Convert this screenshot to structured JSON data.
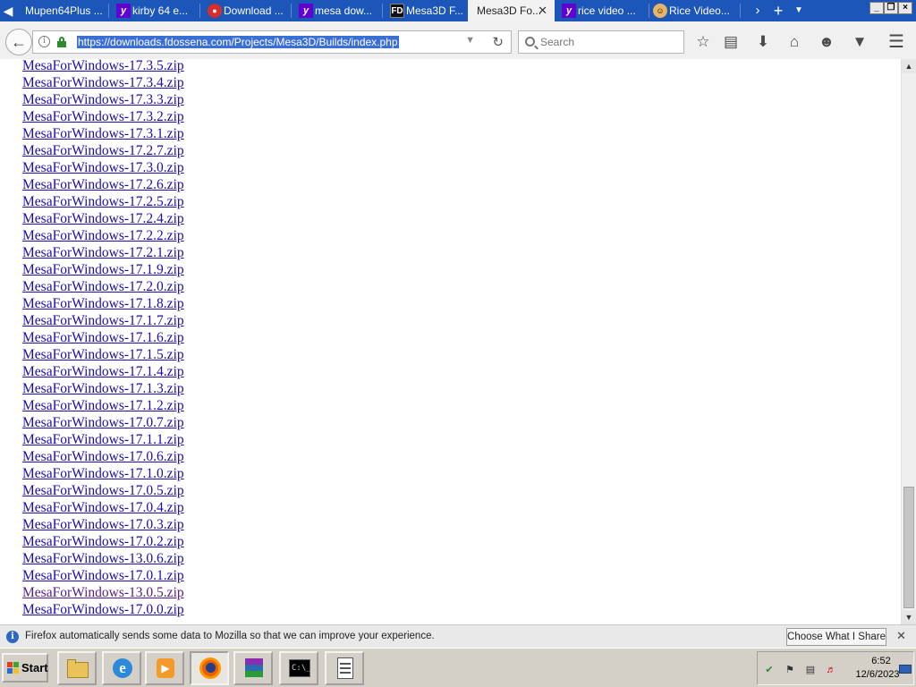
{
  "browser": {
    "tabs": [
      {
        "title": "Mupen64Plus ...",
        "icon": "none",
        "active": false
      },
      {
        "title": "kirby 64 e...",
        "icon": "yahoo",
        "active": false
      },
      {
        "title": "Download ...",
        "icon": "download",
        "active": false
      },
      {
        "title": "mesa dow...",
        "icon": "yahoo",
        "active": false
      },
      {
        "title": "Mesa3D F...",
        "icon": "fd",
        "active": false
      },
      {
        "title": "Mesa3D Fo...",
        "icon": "none",
        "active": true
      },
      {
        "title": "rice video ...",
        "icon": "yahoo",
        "active": false
      },
      {
        "title": "Rice Video...",
        "icon": "rice",
        "active": false
      }
    ],
    "url": "https://downloads.fdossena.com/Projects/Mesa3D/Builds/index.php",
    "search_placeholder": "Search"
  },
  "files": [
    {
      "name": "MesaForWindows-17.3.5.zip",
      "visited": false
    },
    {
      "name": "MesaForWindows-17.3.4.zip",
      "visited": false
    },
    {
      "name": "MesaForWindows-17.3.3.zip",
      "visited": false
    },
    {
      "name": "MesaForWindows-17.3.2.zip",
      "visited": false
    },
    {
      "name": "MesaForWindows-17.3.1.zip",
      "visited": false
    },
    {
      "name": "MesaForWindows-17.2.7.zip",
      "visited": false
    },
    {
      "name": "MesaForWindows-17.3.0.zip",
      "visited": false
    },
    {
      "name": "MesaForWindows-17.2.6.zip",
      "visited": false
    },
    {
      "name": "MesaForWindows-17.2.5.zip",
      "visited": false
    },
    {
      "name": "MesaForWindows-17.2.4.zip",
      "visited": false
    },
    {
      "name": "MesaForWindows-17.2.2.zip",
      "visited": false
    },
    {
      "name": "MesaForWindows-17.2.1.zip",
      "visited": false
    },
    {
      "name": "MesaForWindows-17.1.9.zip",
      "visited": false
    },
    {
      "name": "MesaForWindows-17.2.0.zip",
      "visited": false
    },
    {
      "name": "MesaForWindows-17.1.8.zip",
      "visited": false
    },
    {
      "name": "MesaForWindows-17.1.7.zip",
      "visited": false
    },
    {
      "name": "MesaForWindows-17.1.6.zip",
      "visited": false
    },
    {
      "name": "MesaForWindows-17.1.5.zip",
      "visited": false
    },
    {
      "name": "MesaForWindows-17.1.4.zip",
      "visited": false
    },
    {
      "name": "MesaForWindows-17.1.3.zip",
      "visited": false
    },
    {
      "name": "MesaForWindows-17.1.2.zip",
      "visited": false
    },
    {
      "name": "MesaForWindows-17.0.7.zip",
      "visited": false
    },
    {
      "name": "MesaForWindows-17.1.1.zip",
      "visited": false
    },
    {
      "name": "MesaForWindows-17.0.6.zip",
      "visited": false
    },
    {
      "name": "MesaForWindows-17.1.0.zip",
      "visited": false
    },
    {
      "name": "MesaForWindows-17.0.5.zip",
      "visited": false
    },
    {
      "name": "MesaForWindows-17.0.4.zip",
      "visited": false
    },
    {
      "name": "MesaForWindows-17.0.3.zip",
      "visited": false
    },
    {
      "name": "MesaForWindows-17.0.2.zip",
      "visited": false
    },
    {
      "name": "MesaForWindows-13.0.6.zip",
      "visited": false
    },
    {
      "name": "MesaForWindows-17.0.1.zip",
      "visited": false
    },
    {
      "name": "MesaForWindows-13.0.5.zip",
      "visited": true
    },
    {
      "name": "MesaForWindows-17.0.0.zip",
      "visited": false
    }
  ],
  "notification": {
    "text": "Firefox automatically sends some data to Mozilla so that we can improve your experience.",
    "button": "Choose What I Share"
  },
  "taskbar": {
    "start_label": "Start",
    "apps": [
      {
        "name": "file-explorer"
      },
      {
        "name": "internet-explorer"
      },
      {
        "name": "media-player"
      },
      {
        "name": "firefox",
        "active": true
      },
      {
        "name": "winrar"
      },
      {
        "name": "command-prompt"
      },
      {
        "name": "text-document"
      }
    ],
    "clock_time": "6:52",
    "clock_date": "12/6/2023"
  },
  "colors": {
    "tabbar": "#1b56b8",
    "link": "#1a0dab",
    "visited_link": "#551a8b",
    "url_selection": "#3b6fd6"
  }
}
